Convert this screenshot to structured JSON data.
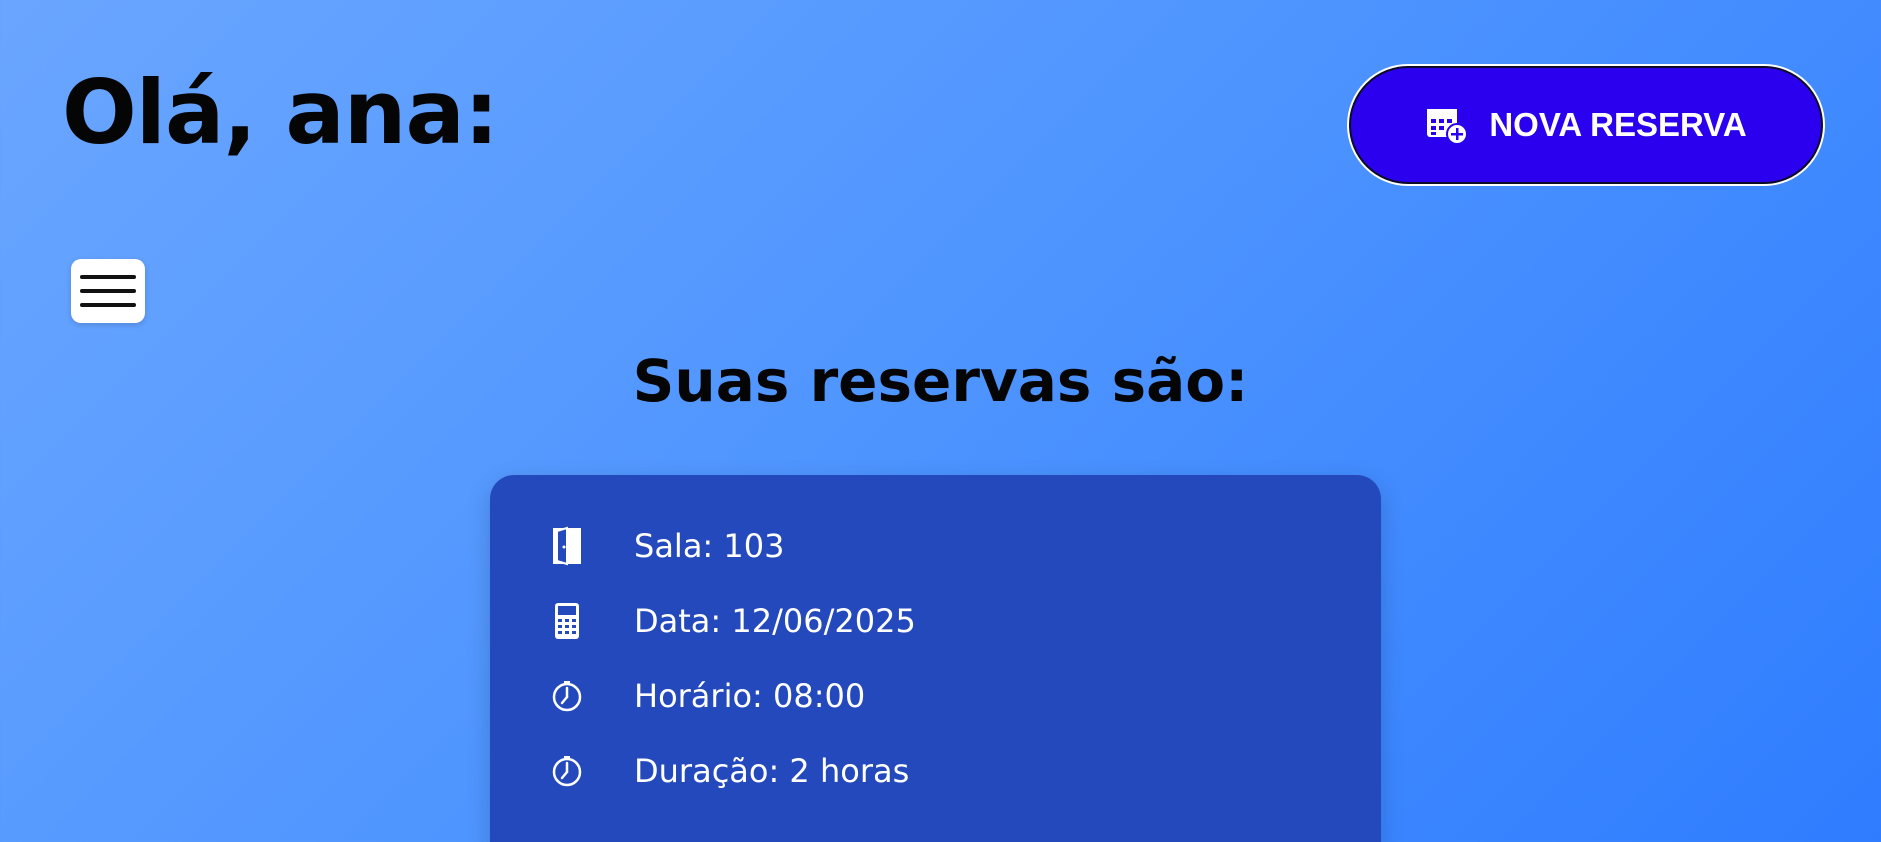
{
  "header": {
    "greeting": "Olá, ana:",
    "new_reservation_label": "NOVA RESERVA",
    "new_reservation_icon": "calendar-plus-icon",
    "menu_icon": "hamburger-menu-icon"
  },
  "main": {
    "title": "Suas reservas são:"
  },
  "reservation": {
    "room": {
      "icon": "door-icon",
      "text": "Sala: 103"
    },
    "date": {
      "icon": "calendar-icon",
      "text": "Data: 12/06/2025"
    },
    "time": {
      "icon": "stopwatch-icon",
      "text": "Horário: 08:00"
    },
    "duration": {
      "icon": "stopwatch-icon",
      "text": "Duração: 2 horas"
    }
  },
  "colors": {
    "background_start": "#6aa6ff",
    "background_end": "#2f7dff",
    "button": "#2a00ee",
    "card": "#2449bd"
  }
}
